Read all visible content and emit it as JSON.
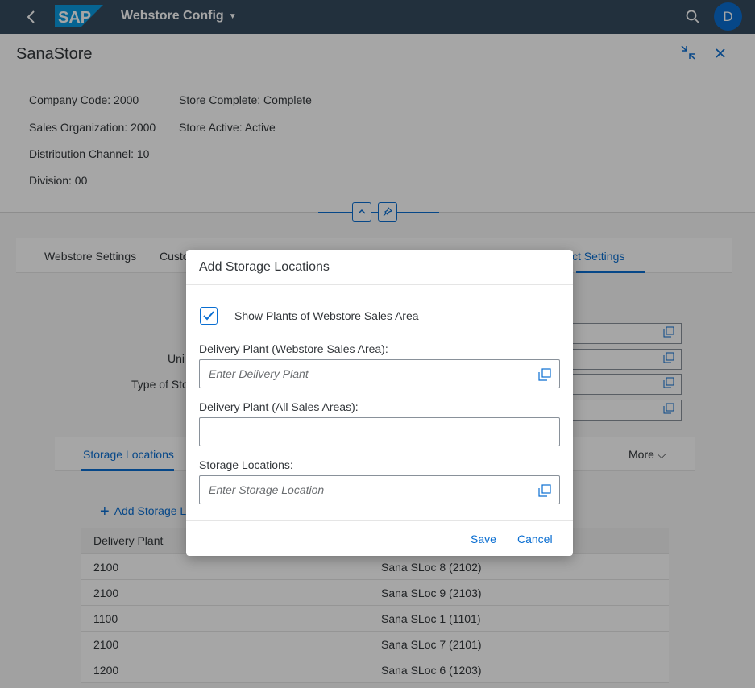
{
  "shell": {
    "app_title": "Webstore Config",
    "avatar_initial": "D",
    "logo_text": "SAP"
  },
  "header": {
    "title": "SanaStore",
    "attributes_left": [
      "Company Code: 2000",
      "Sales Organization: 2000",
      "Distribution Channel: 10",
      "Division: 00"
    ],
    "attributes_right": [
      "Store Complete: Complete",
      "Store Active: Active"
    ]
  },
  "tabs": [
    "Webstore Settings",
    "Custo",
    "ct Settings"
  ],
  "form_labels": [
    "Uni",
    "Type of Sto"
  ],
  "subtabs": {
    "active": "Storage Locations",
    "more": "More"
  },
  "add_button_label": "Add Storage L",
  "table": {
    "columns": [
      "Delivery Plant"
    ],
    "rows": [
      {
        "plant": "2100",
        "location": "Sana SLoc 8 (2102)"
      },
      {
        "plant": "2100",
        "location": "Sana SLoc 9 (2103)"
      },
      {
        "plant": "1100",
        "location": "Sana SLoc 1 (1101)"
      },
      {
        "plant": "2100",
        "location": "Sana SLoc 7 (2101)"
      },
      {
        "plant": "1200",
        "location": "Sana SLoc 6 (1203)"
      }
    ]
  },
  "dialog": {
    "title": "Add Storage Locations",
    "checkbox_label": "Show Plants of Webstore Sales Area",
    "checkbox_checked": true,
    "field1_label": "Delivery Plant (Webstore Sales Area):",
    "field1_placeholder": "Enter Delivery Plant",
    "field2_label": "Delivery Plant (All Sales Areas):",
    "field2_value": "",
    "field3_label": "Storage Locations:",
    "field3_placeholder": "Enter Storage Location",
    "save_label": "Save",
    "cancel_label": "Cancel"
  },
  "colors": {
    "shell": "#354a5f",
    "accent": "#0a6ed1",
    "text": "#32363a"
  }
}
